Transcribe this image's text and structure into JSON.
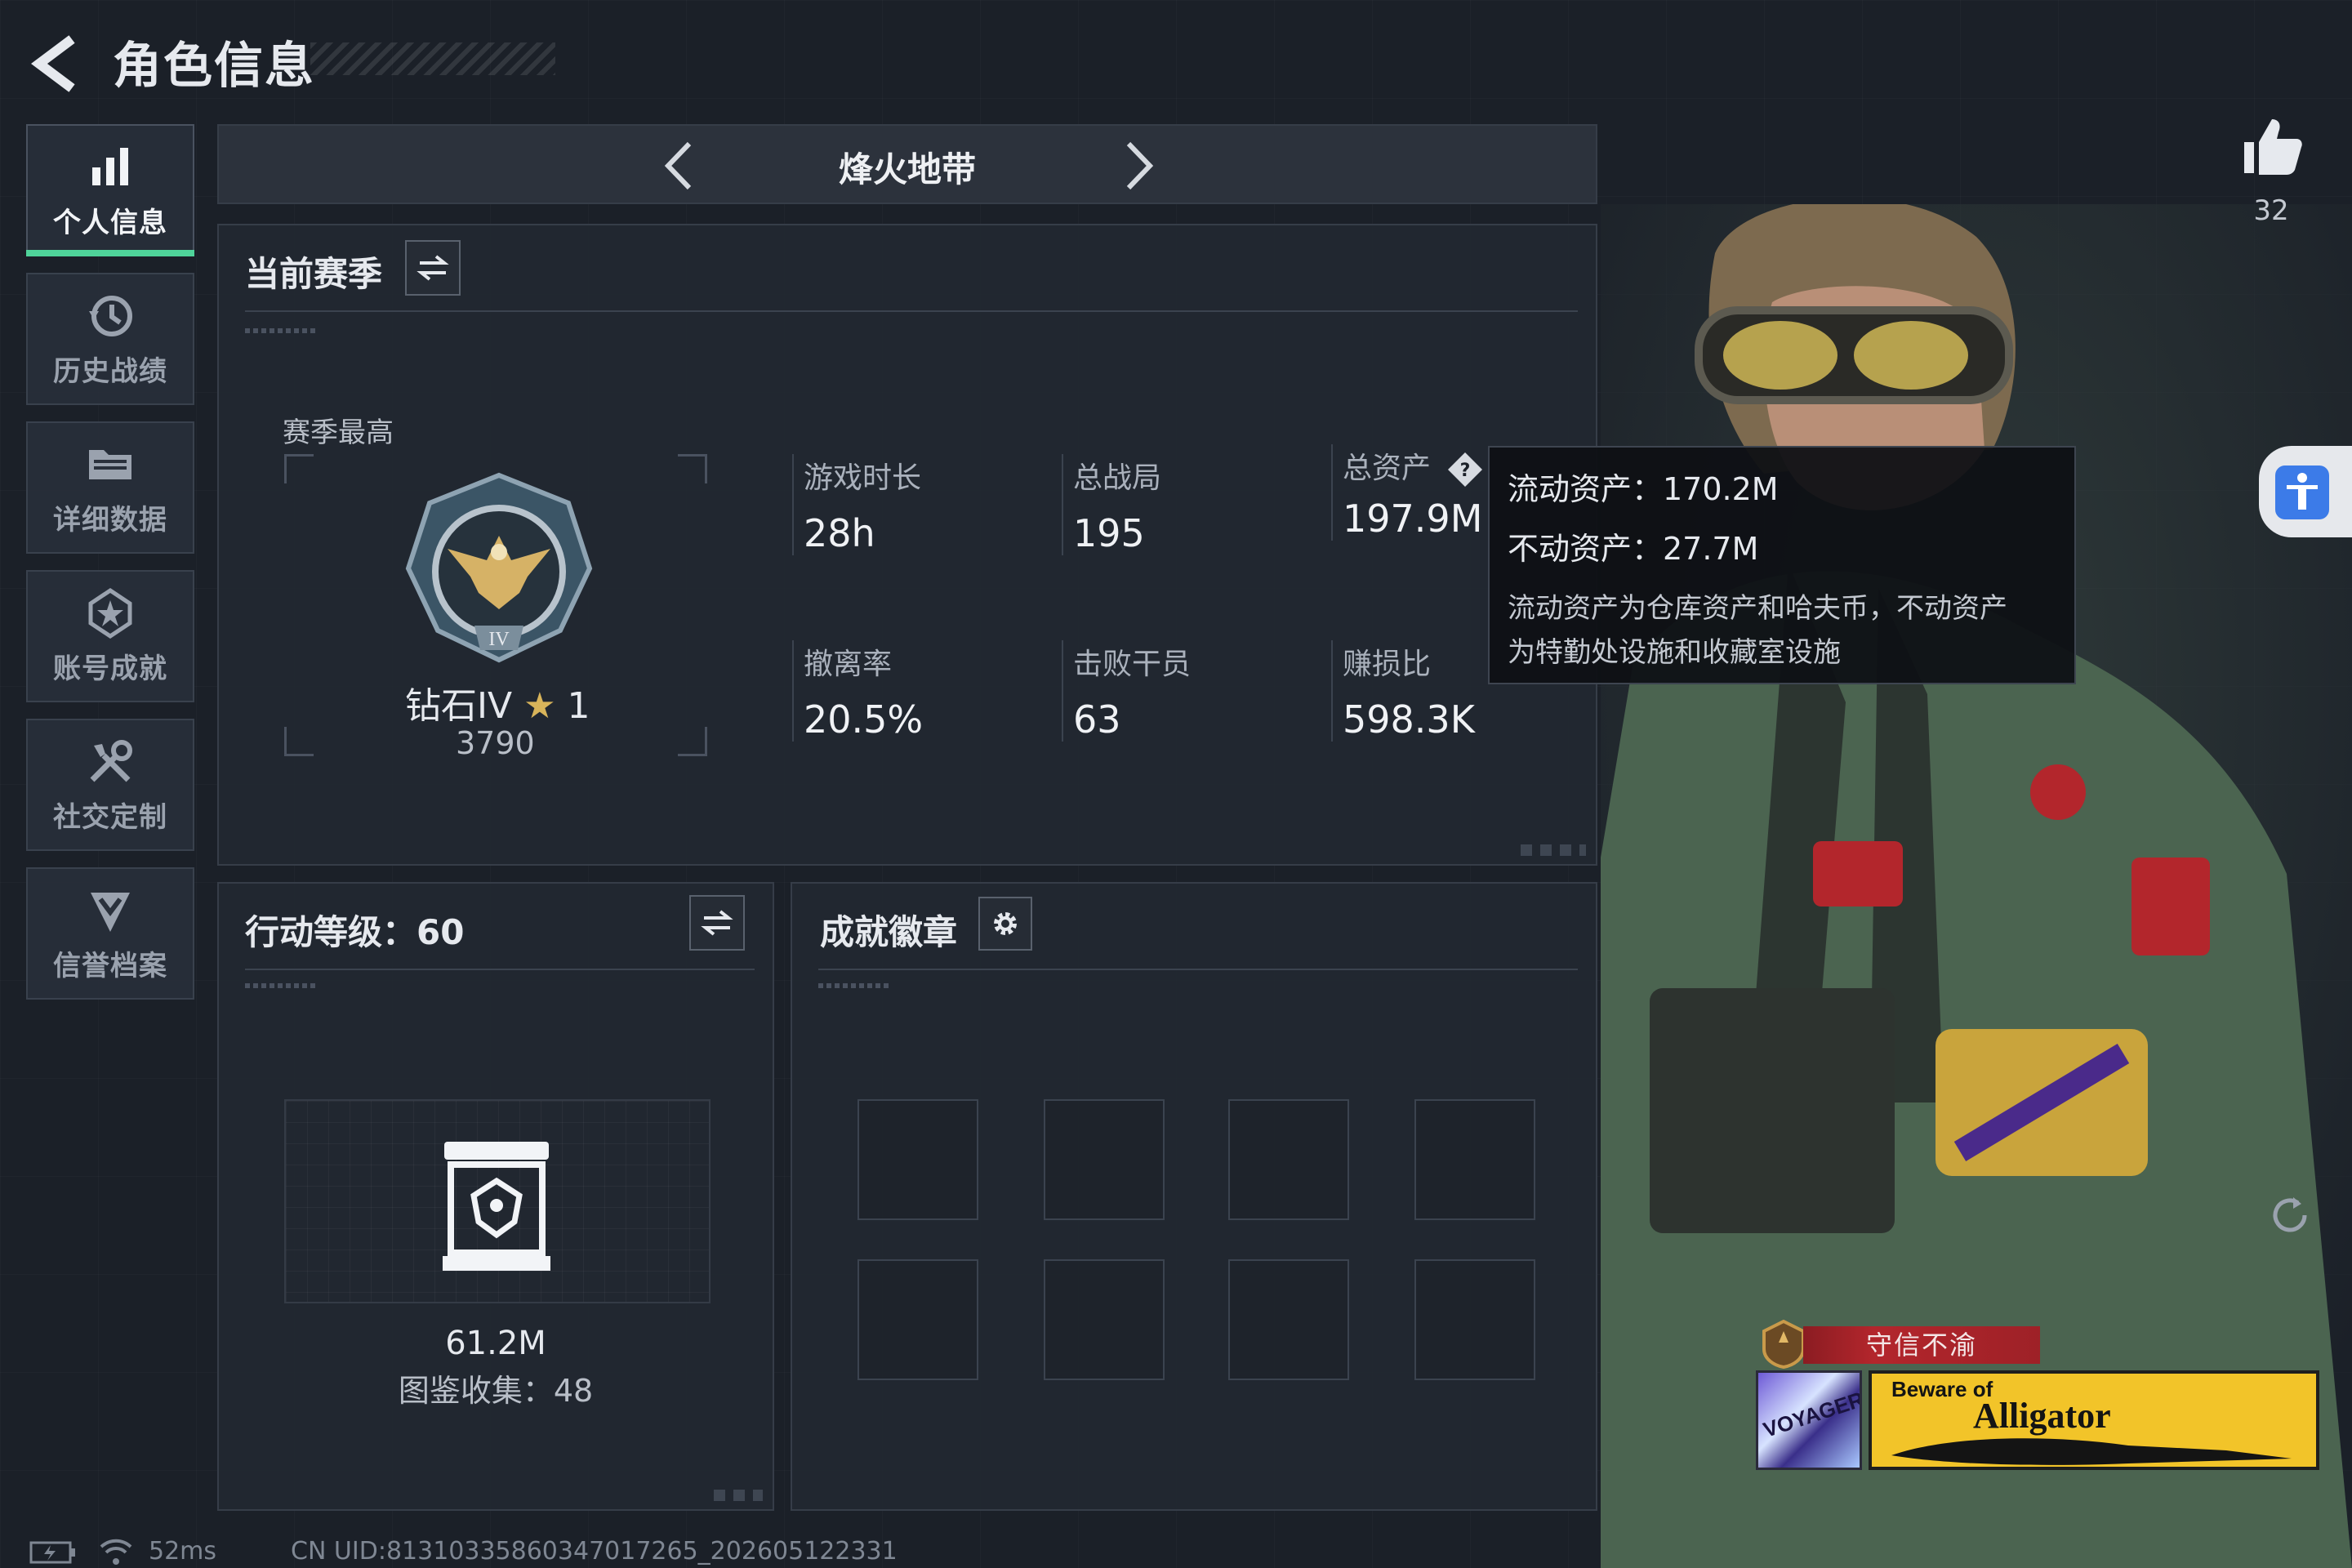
{
  "header": {
    "title": "角色信息"
  },
  "sidebar": {
    "items": [
      {
        "label": "个人信息",
        "icon": "bar-chart-icon",
        "active": true
      },
      {
        "label": "历史战绩",
        "icon": "history-clock-icon",
        "active": false
      },
      {
        "label": "详细数据",
        "icon": "folder-icon",
        "active": false
      },
      {
        "label": "账号成就",
        "icon": "achievement-star-icon",
        "active": false
      },
      {
        "label": "社交定制",
        "icon": "tools-icon",
        "active": false
      },
      {
        "label": "信誉档案",
        "icon": "shield-chevron-icon",
        "active": false
      }
    ]
  },
  "map_selector": {
    "current": "烽火地带"
  },
  "season": {
    "title": "当前赛季",
    "best_label": "赛季最高",
    "rank_name": "钻石IV",
    "rank_stars": "1",
    "rank_score": "3790",
    "stats": [
      {
        "label": "游戏时长",
        "value": "28h"
      },
      {
        "label": "总战局",
        "value": "195"
      },
      {
        "label": "总资产",
        "value": "197.9M"
      },
      {
        "label": "撤离率",
        "value": "20.5%"
      },
      {
        "label": "击败干员",
        "value": "63"
      },
      {
        "label": "赚损比",
        "value": "598.3K"
      }
    ]
  },
  "tooltip": {
    "liquid": "流动资产：170.2M",
    "fixed": "不动资产：27.7M",
    "desc_line1": "流动资产为仓库资产和哈夫币，不动资产",
    "desc_line2": "为特勤处设施和收藏室设施"
  },
  "action_level": {
    "title": "行动等级：60",
    "value": "61.2M",
    "codex": "图鉴收集：48"
  },
  "badges": {
    "title": "成就徽章",
    "slots": 8
  },
  "profile": {
    "likes": "32",
    "banner_title": "守信不渝",
    "sticker_a": "VOYAGER",
    "sticker_b_top": "Beware of",
    "sticker_b_main": "Alligator"
  },
  "status": {
    "ping": "52ms",
    "uid": "CN UID:813103358603470172​65_202605122331"
  },
  "colors": {
    "accent_green": "#4fd39a",
    "background": "#1b2028",
    "banner_red": "#b3262c",
    "sticker_yellow": "#f2c429"
  }
}
